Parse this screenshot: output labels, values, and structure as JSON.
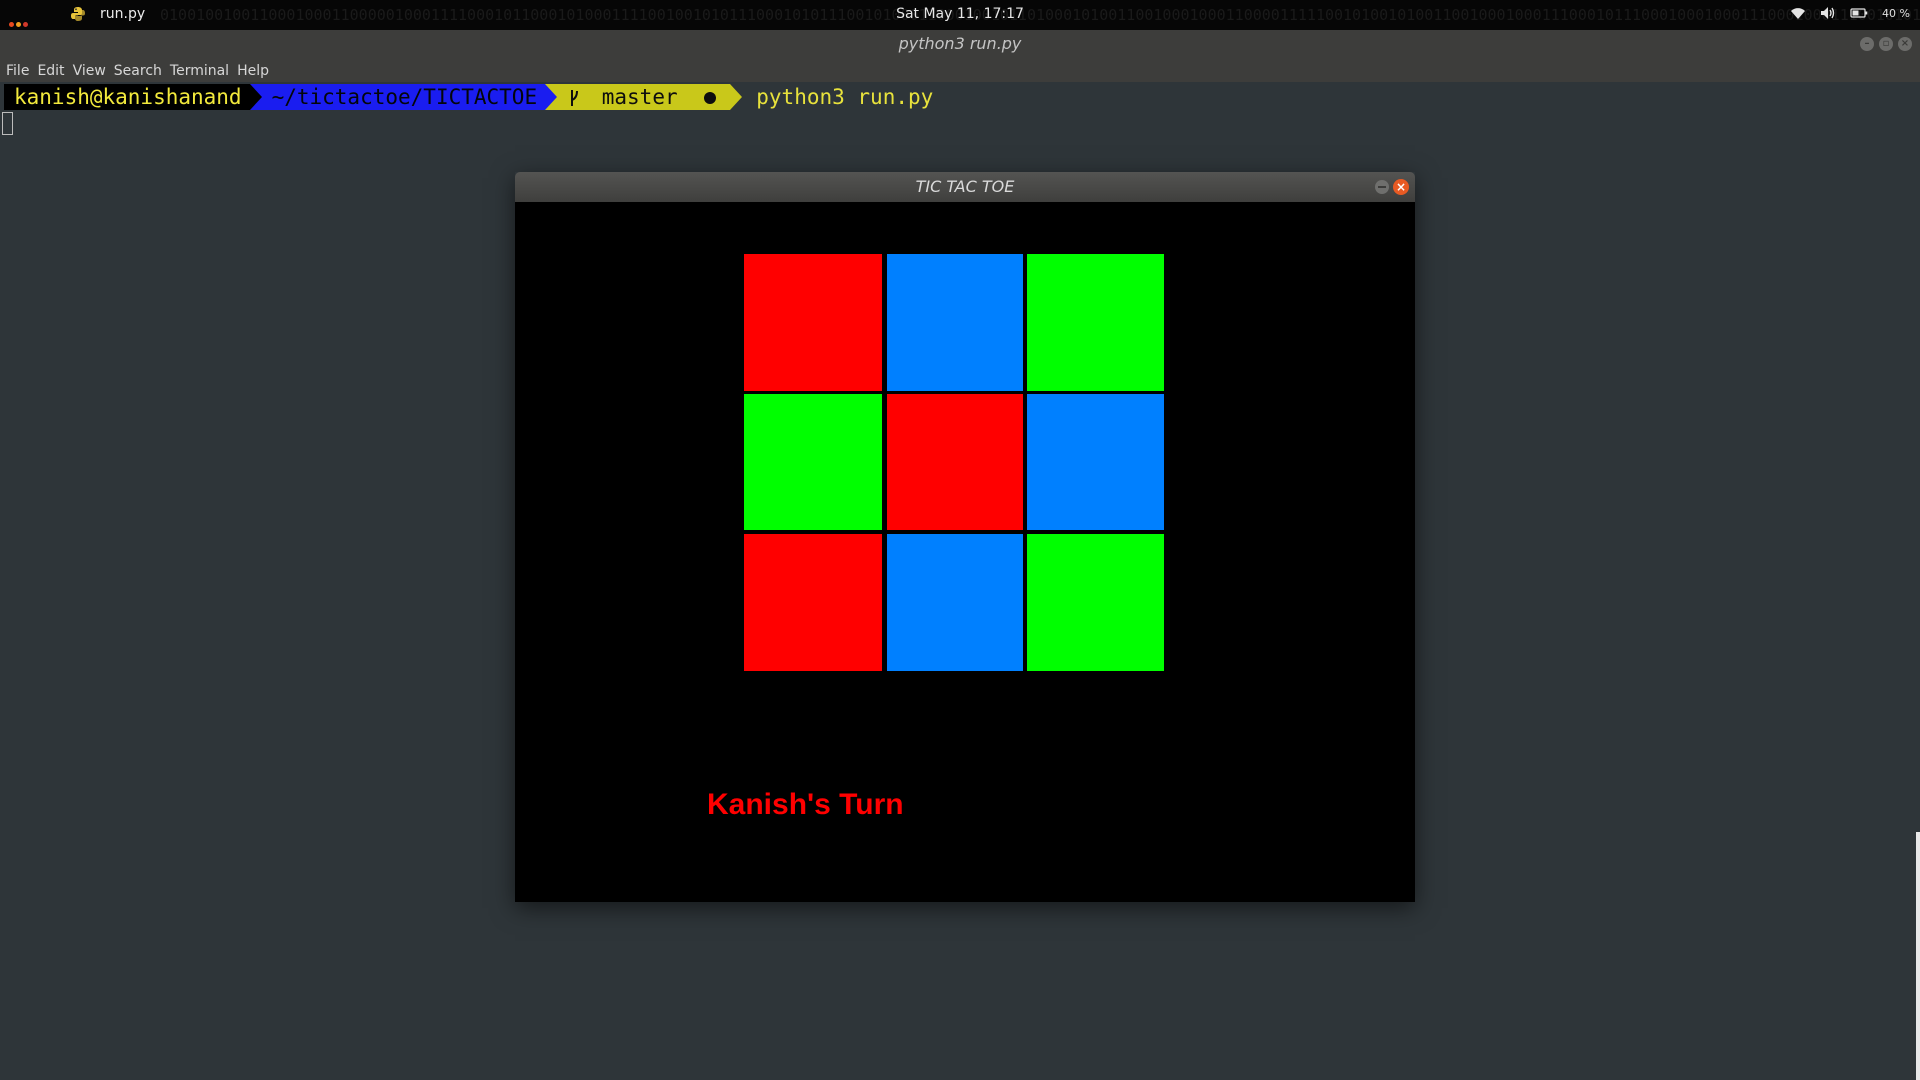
{
  "top_panel": {
    "app_name": "run.py",
    "clock": "Sat May 11, 17:17",
    "battery": "40 %",
    "background_pattern": "010010010011000100011000001000111100010110001010001111001001010111000101011100101000110001001011010001010011001000100011000011111001010010100110010001000111000101110001000100011100010001110010101011100111",
    "icons": [
      "wifi-icon",
      "volume-icon",
      "battery-icon"
    ]
  },
  "terminal": {
    "title": "python3 run.py",
    "menu": [
      "File",
      "Edit",
      "View",
      "Search",
      "Terminal",
      "Help"
    ],
    "prompt": {
      "user_host": "kanish@kanishanand",
      "directory": "~/tictactoe/TICTACTOE",
      "git_branch": "master",
      "command": "python3 run.py"
    }
  },
  "game_window": {
    "title": "TIC TAC TOE",
    "turn_text": "Kanish's Turn",
    "turn_color": "#ff0000",
    "board": [
      [
        "red",
        "blue",
        "green"
      ],
      [
        "green",
        "red",
        "blue"
      ],
      [
        "red",
        "blue",
        "green"
      ]
    ],
    "palette": {
      "red": "#ff0000",
      "blue": "#0080ff",
      "green": "#00ff00"
    }
  }
}
